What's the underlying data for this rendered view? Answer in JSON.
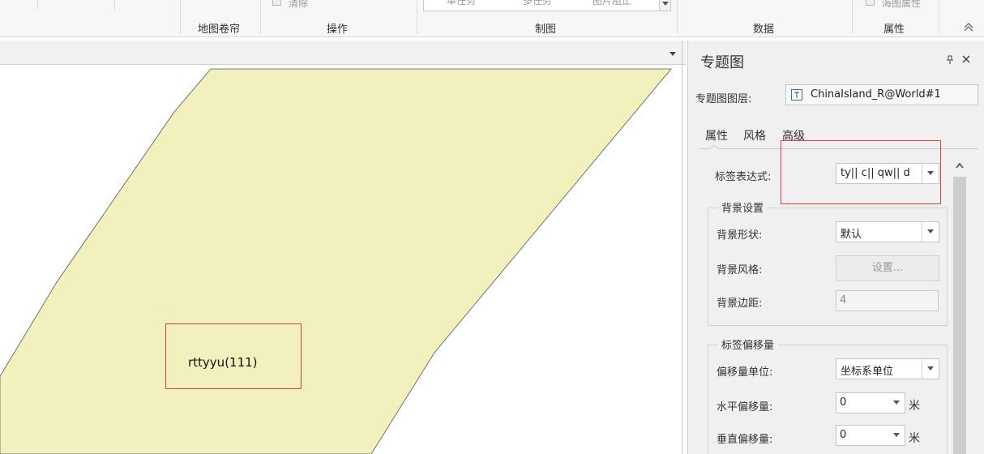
{
  "ribbon": {
    "partial_clear_label": "清除",
    "partial_gallery_items": [
      "单任务",
      "多任务",
      "图片阻止"
    ],
    "partial_map_property_label": "海图属性",
    "group_labels": {
      "map_swipe": "地图卷帘",
      "operation": "操作",
      "mapping": "制图",
      "data": "数据",
      "property": "属性"
    }
  },
  "map": {
    "label_text": "rttyyu(111)",
    "fill_color": "#f2f0bd",
    "highlight_color": "#e04040"
  },
  "panel": {
    "title": "专题图",
    "layer_label": "专题图图层:",
    "layer_value": "ChinaIsland_R@World#1",
    "tabs": [
      {
        "label": "属性",
        "selected": true
      },
      {
        "label": "风格",
        "selected": false
      },
      {
        "label": "高级",
        "selected": false
      }
    ],
    "label_expression_label": "标签表达式:",
    "label_expression_value": "ty|| c|| qw|| d",
    "background": {
      "group_label": "背景设置",
      "shape_label": "背景形状:",
      "shape_value": "默认",
      "style_label": "背景风格:",
      "style_button": "设置...",
      "margin_label": "背景边距:",
      "margin_value": "4"
    },
    "offset": {
      "group_label": "标签偏移量",
      "unit_label": "偏移量单位:",
      "unit_value": "坐标系单位",
      "horizontal_label": "水平偏移量:",
      "horizontal_value": "0",
      "vertical_label": "垂直偏移量:",
      "vertical_value": "0",
      "meter_unit": "米"
    }
  }
}
